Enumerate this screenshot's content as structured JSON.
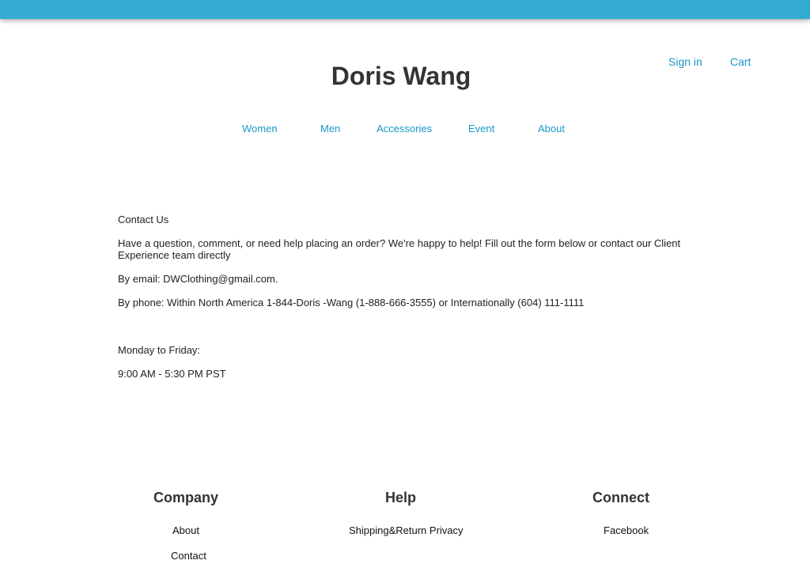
{
  "colors": {
    "top_bar": "#35aad1",
    "link": "#1a97c9",
    "heading": "#333333"
  },
  "header": {
    "brand": "Doris Wang",
    "sign_in": "Sign in",
    "cart": "Cart"
  },
  "nav": {
    "items": [
      {
        "label": "Women"
      },
      {
        "label": "Men"
      },
      {
        "label": "Accessories"
      },
      {
        "label": "Event"
      },
      {
        "label": "About"
      }
    ]
  },
  "contact": {
    "title": "Contact Us",
    "intro": "Have a question, comment, or need help placing an order? We're happy to help! Fill out the form below or contact our Client Experience team directly",
    "email": "By email: DWClothing@gmail.com.",
    "phone": "By phone: Within North America 1-844-Doris -Wang (1-888-666-3555) or Internationally (604) 111-1111",
    "days": "Monday to Friday:",
    "hours": "9:00 AM - 5:30 PM PST"
  },
  "footer": {
    "company": {
      "heading": "Company",
      "links": [
        "About",
        "Contact"
      ]
    },
    "help": {
      "heading": "Help",
      "links": [
        "Shipping&Return Privacy"
      ]
    },
    "connect": {
      "heading": "Connect",
      "links": [
        "Facebook"
      ]
    }
  }
}
